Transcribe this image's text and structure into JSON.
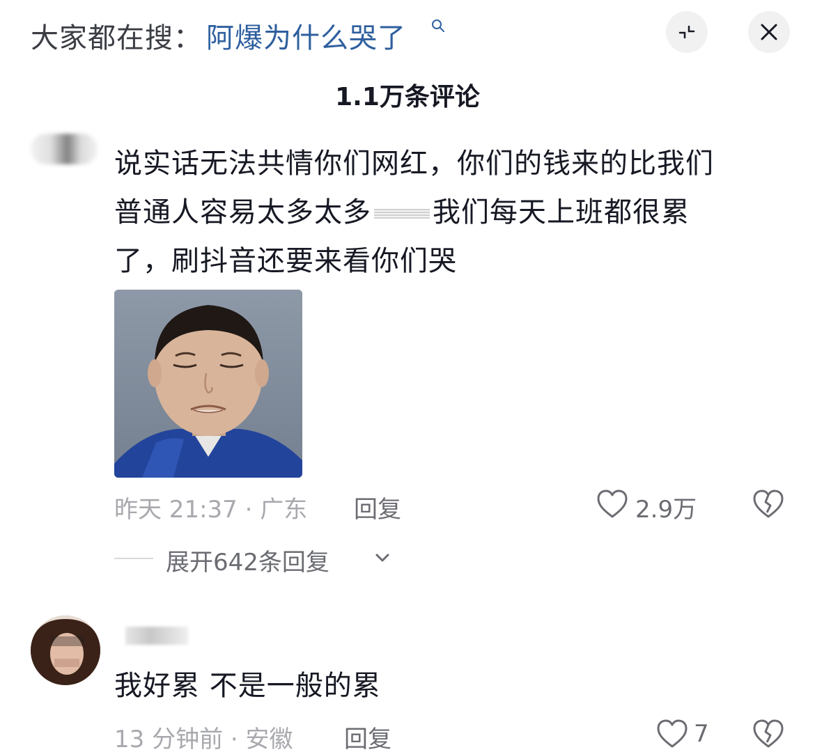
{
  "search_bar": {
    "prefix": "大家都在搜：",
    "term": "阿爆为什么哭了"
  },
  "comments_header": {
    "count_label": "1.1万条评论"
  },
  "comments": [
    {
      "text_line1": "说实话无法共情你们网红，你们的钱来的比我们",
      "text_line2a": "普通人容易太多太多",
      "text_line2b": "我们每天上班都很累",
      "text_line3": "了，刷抖音还要来看你们哭",
      "meta": "昨天 21:37 · 广东",
      "reply_label": "回复",
      "likes": "2.9万",
      "expand_label": "展开642条回复"
    },
    {
      "text": "我好累 不是一般的累",
      "meta": "13 分钟前 · 安徽",
      "reply_label": "回复",
      "likes": "7"
    }
  ],
  "icons": [
    "search-icon",
    "collapse-icon",
    "close-icon",
    "heart-icon",
    "broken-heart-icon",
    "chevron-down-icon"
  ]
}
